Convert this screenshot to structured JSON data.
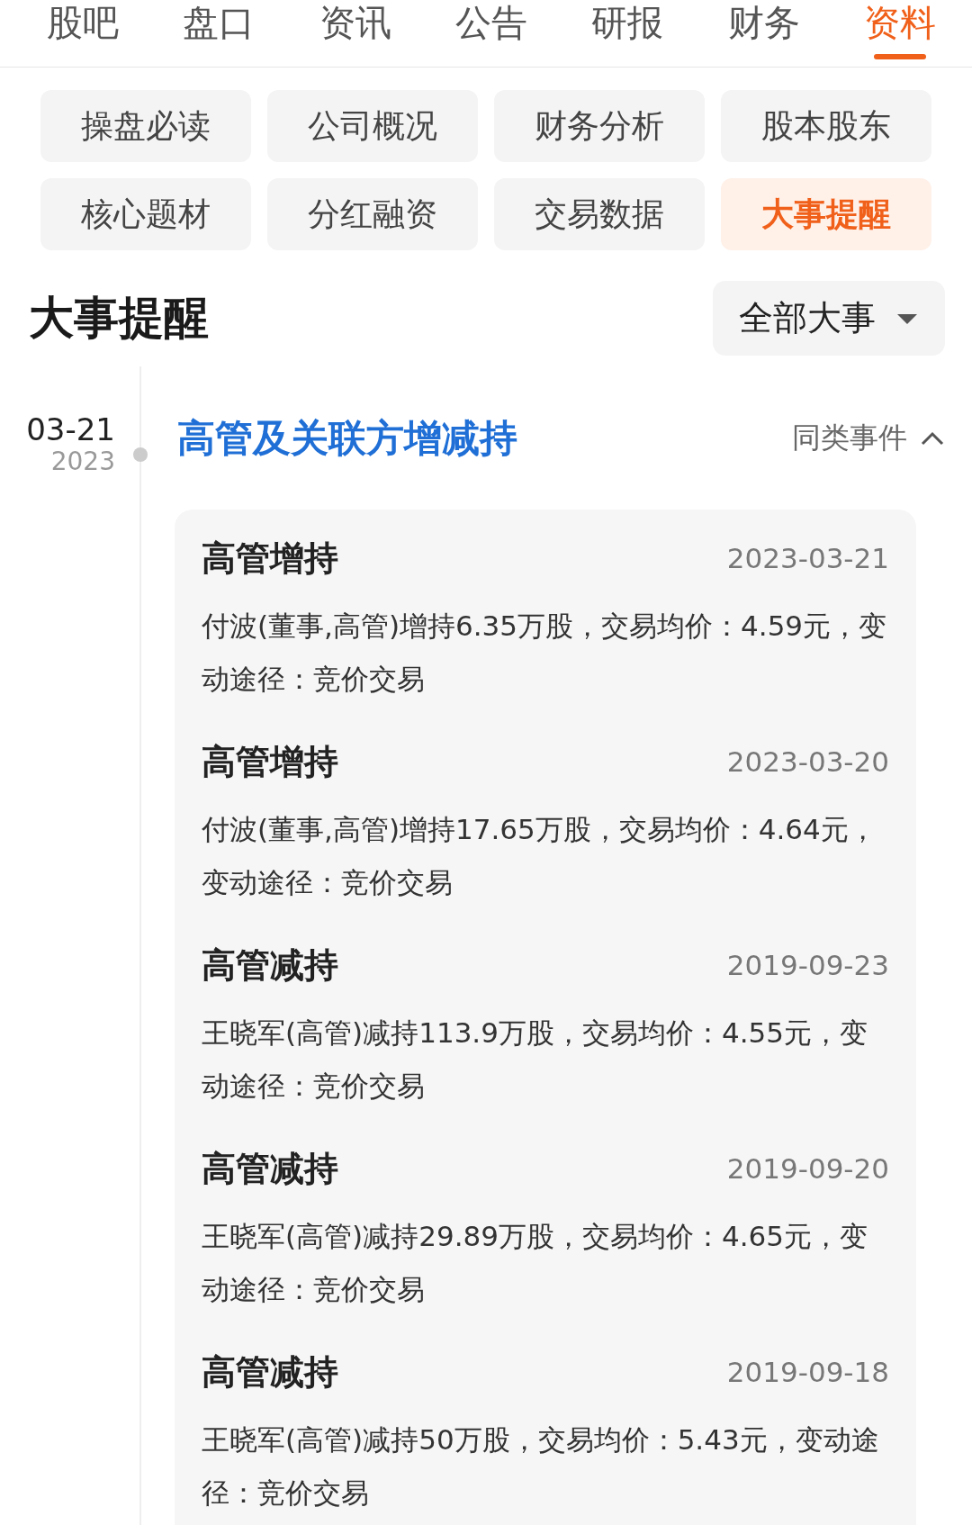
{
  "nav_tabs": [
    {
      "label": "股吧",
      "selected": false
    },
    {
      "label": "盘口",
      "selected": false
    },
    {
      "label": "资讯",
      "selected": false
    },
    {
      "label": "公告",
      "selected": false
    },
    {
      "label": "研报",
      "selected": false
    },
    {
      "label": "财务",
      "selected": false
    },
    {
      "label": "资料",
      "selected": true
    }
  ],
  "sub_menu": [
    {
      "label": "操盘必读",
      "selected": false
    },
    {
      "label": "公司概况",
      "selected": false
    },
    {
      "label": "财务分析",
      "selected": false
    },
    {
      "label": "股本股东",
      "selected": false
    },
    {
      "label": "核心题材",
      "selected": false
    },
    {
      "label": "分红融资",
      "selected": false
    },
    {
      "label": "交易数据",
      "selected": false
    },
    {
      "label": "大事提醒",
      "selected": true
    }
  ],
  "section": {
    "title": "大事提醒",
    "filter": {
      "value": "全部大事"
    }
  },
  "timeline": [
    {
      "date": "03-21",
      "year": "2023",
      "title": "高管及关联方增减持",
      "similar_label": "同类事件",
      "expanded": true,
      "events": [
        {
          "title": "高管增持",
          "date": "2023-03-21",
          "description": "付波(董事,高管)增持6.35万股，交易均价：4.59元，变动途径：竞价交易"
        },
        {
          "title": "高管增持",
          "date": "2023-03-20",
          "description": "付波(董事,高管)增持17.65万股，交易均价：4.64元，变动途径：竞价交易"
        },
        {
          "title": "高管减持",
          "date": "2019-09-23",
          "description": "王晓军(高管)减持113.9万股，交易均价：4.55元，变动途径：竞价交易"
        },
        {
          "title": "高管减持",
          "date": "2019-09-20",
          "description": "王晓军(高管)减持29.89万股，交易均价：4.65元，变动途径：竞价交易"
        },
        {
          "title": "高管减持",
          "date": "2019-09-18",
          "description": "王晓军(高管)减持50万股，交易均价：5.43元，变动途径：竞价交易"
        }
      ]
    }
  ]
}
